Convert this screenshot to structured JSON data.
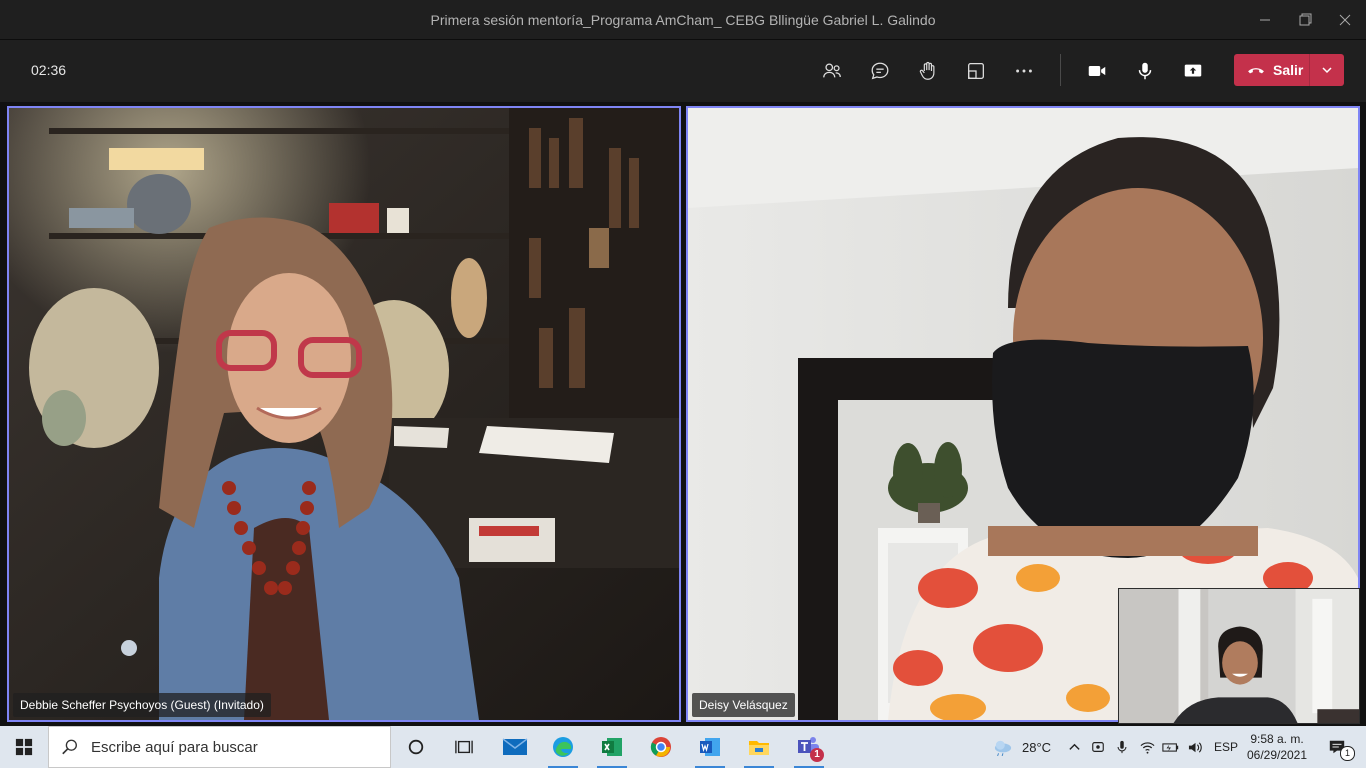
{
  "window": {
    "title": "Primera sesión mentoría_Programa AmCham_ CEBG Bllingüe Gabriel L. Galindo"
  },
  "meeting": {
    "timer": "02:36",
    "leave_label": "Salir",
    "controls": [
      {
        "name": "participants-icon"
      },
      {
        "name": "chat-icon"
      },
      {
        "name": "raise-hand-icon"
      },
      {
        "name": "rooms-icon"
      },
      {
        "name": "more-options-icon"
      },
      {
        "name": "camera-icon"
      },
      {
        "name": "microphone-icon"
      },
      {
        "name": "share-screen-icon"
      }
    ]
  },
  "participants": [
    {
      "name": "Debbie Scheffer Psychoyos (Guest) (Invitado)"
    },
    {
      "name": "Deisy Velásquez"
    }
  ],
  "taskbar": {
    "search_placeholder": "Escribe aquí para buscar",
    "apps": [
      "start-icon",
      "task-view-icon",
      "mail-icon",
      "edge-icon",
      "excel-icon",
      "chrome-icon",
      "word-icon",
      "file-explorer-icon",
      "teams-icon"
    ],
    "teams_badge": "1",
    "weather_temp": "28°C",
    "language": "ESP",
    "time": "9:58 a. m.",
    "date": "06/29/2021",
    "notification_count": "1"
  },
  "colors": {
    "accent": "#7f85f5",
    "leave": "#c4314b",
    "taskbar": "#dfe6ee"
  }
}
